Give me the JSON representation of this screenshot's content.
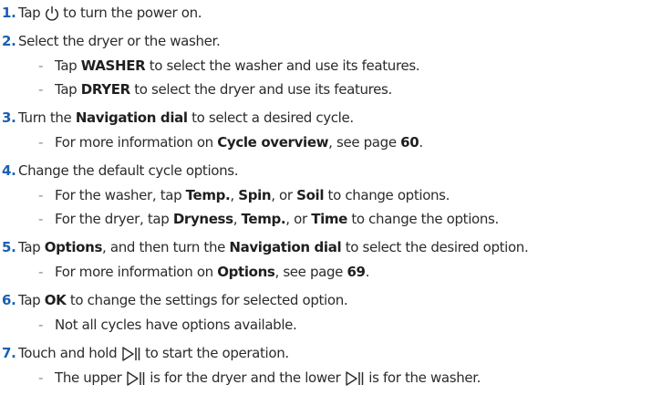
{
  "steps": [
    {
      "num": "1.",
      "pre": "Tap ",
      "icon": "power-icon",
      "post": " to turn the power on."
    },
    {
      "num": "2.",
      "text": "Select the dryer or the washer."
    },
    {
      "num": "3.",
      "pre": "Turn the ",
      "bold": "Navigation dial",
      "post": " to select a desired cycle."
    },
    {
      "num": "4.",
      "text": "Change the default cycle options."
    },
    {
      "num": "5.",
      "pre": "Tap ",
      "bold1": "Options",
      "mid": ", and then turn the ",
      "bold2": "Navigation dial",
      "post": " to select the desired option."
    },
    {
      "num": "6.",
      "pre": "Tap ",
      "bold": "OK",
      "post": " to change the settings for selected option."
    },
    {
      "num": "7.",
      "pre": "Touch and hold ",
      "icon": "start-pause-icon",
      "post": " to start the operation."
    }
  ],
  "subs": {
    "s2a": {
      "dash": "-",
      "pre": "Tap ",
      "bold": "WASHER",
      "post": " to select the washer and use its features."
    },
    "s2b": {
      "dash": "-",
      "pre": "Tap ",
      "bold": "DRYER",
      "post": " to select the dryer and use its features."
    },
    "s3a": {
      "dash": "-",
      "pre": "For more information on ",
      "bold": "Cycle overview",
      "mid": ", see page ",
      "page": "60",
      "post": "."
    },
    "s4a": {
      "dash": "-",
      "pre": "For the washer, tap ",
      "b1": "Temp.",
      "m1": ", ",
      "b2": "Spin",
      "m2": ", or ",
      "b3": "Soil",
      "post": " to change options."
    },
    "s4b": {
      "dash": "-",
      "pre": "For the dryer, tap ",
      "b1": "Dryness",
      "m1": ", ",
      "b2": "Temp.",
      "m2": ", or ",
      "b3": "Time",
      "post": " to change the options."
    },
    "s5a": {
      "dash": "-",
      "pre": "For more information on ",
      "bold": "Options",
      "mid": ", see page ",
      "page": "69",
      "post": "."
    },
    "s6a": {
      "dash": "-",
      "text": "Not all cycles have options available."
    },
    "s7a": {
      "dash": "-",
      "pre": "The upper ",
      "icon1": "start-pause-icon",
      "mid": " is for the dryer and the lower ",
      "icon2": "start-pause-icon",
      "post": " is for the washer."
    }
  },
  "colors": {
    "text": "#2b2b2b",
    "step_number": "#1a5fb4",
    "dash": "#8a8a8a"
  }
}
